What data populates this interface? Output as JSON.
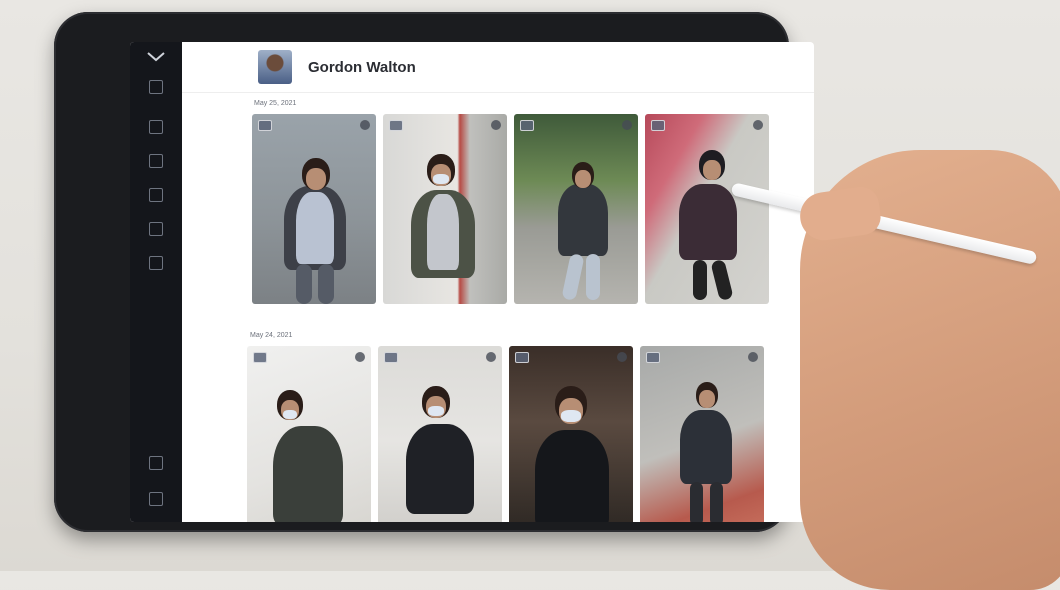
{
  "profile": {
    "name": "Gordon Walton"
  },
  "sidebar": {
    "items": [
      {
        "label": "",
        "icon": "cameras-icon"
      },
      {
        "label": "",
        "icon": "alerts-icon"
      },
      {
        "label": "",
        "icon": "search-icon"
      },
      {
        "label": "",
        "icon": "people-icon"
      },
      {
        "label": "",
        "icon": "vehicles-icon"
      },
      {
        "label": "",
        "icon": "reports-icon"
      },
      {
        "label": "",
        "icon": "settings-icon"
      },
      {
        "label": "",
        "icon": "user-icon"
      }
    ]
  },
  "sections": [
    {
      "date": "May 25, 2021",
      "cards": [
        {
          "tag": "",
          "caption": ""
        },
        {
          "tag": "",
          "caption": ""
        },
        {
          "tag": "",
          "caption": ""
        },
        {
          "tag": "",
          "caption": ""
        }
      ]
    },
    {
      "date": "May 24, 2021",
      "cards": [
        {
          "tag": "",
          "caption": ""
        },
        {
          "tag": "",
          "caption": ""
        },
        {
          "tag": "",
          "caption": ""
        },
        {
          "tag": "",
          "caption": ""
        }
      ]
    }
  ],
  "colors": {
    "sidebar_bg": "#14161b",
    "device_frame": "#1b1c1f",
    "screen_bg": "#ffffff"
  }
}
